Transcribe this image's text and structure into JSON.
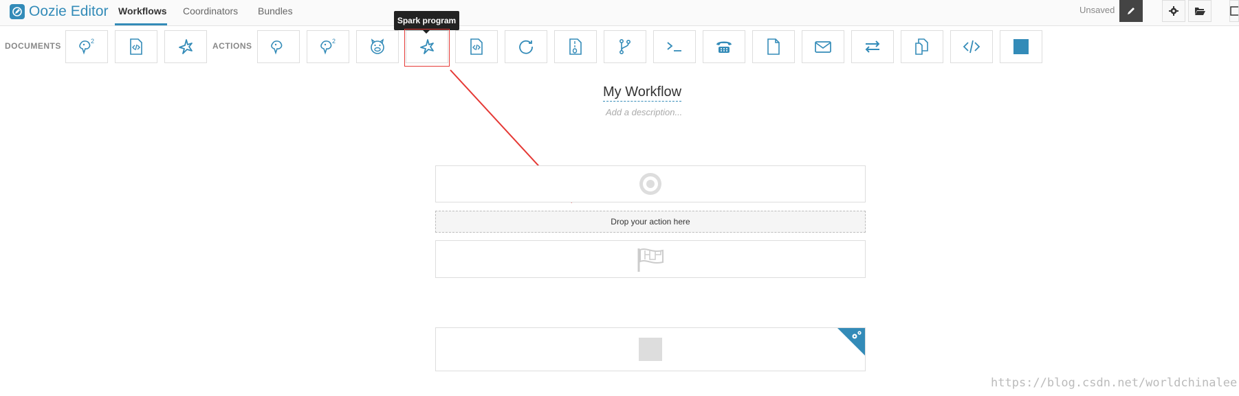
{
  "header": {
    "app_title": "Oozie Editor",
    "tabs": [
      {
        "label": "Workflows",
        "active": true
      },
      {
        "label": "Coordinators",
        "active": false
      },
      {
        "label": "Bundles",
        "active": false
      }
    ],
    "status": "Unsaved"
  },
  "toolbar": {
    "documents_label": "DOCUMENTS",
    "actions_label": "ACTIONS",
    "documents": [
      {
        "icon": "hive2-icon"
      },
      {
        "icon": "script-file-icon"
      },
      {
        "icon": "spark-icon"
      }
    ],
    "actions": [
      {
        "icon": "hive-icon"
      },
      {
        "icon": "hive2-icon"
      },
      {
        "icon": "pig-icon"
      },
      {
        "icon": "spark-icon"
      },
      {
        "icon": "script-file-icon"
      },
      {
        "icon": "subworkflow-icon"
      },
      {
        "icon": "jar-file-icon"
      },
      {
        "icon": "fork-icon"
      },
      {
        "icon": "shell-icon"
      },
      {
        "icon": "ssh-icon"
      },
      {
        "icon": "fs-file-icon"
      },
      {
        "icon": "email-icon"
      },
      {
        "icon": "transfer-icon"
      },
      {
        "icon": "distcp-icon"
      },
      {
        "icon": "code-icon"
      },
      {
        "icon": "kill-icon"
      }
    ],
    "tooltip": "Spark program"
  },
  "workflow": {
    "name": "My Workflow",
    "description_placeholder": "Add a description...",
    "drop_hint": "Drop your action here"
  },
  "watermark": "https://blog.csdn.net/worldchinalee",
  "colors": {
    "accent": "#338bb8",
    "annotation": "#e53935"
  }
}
